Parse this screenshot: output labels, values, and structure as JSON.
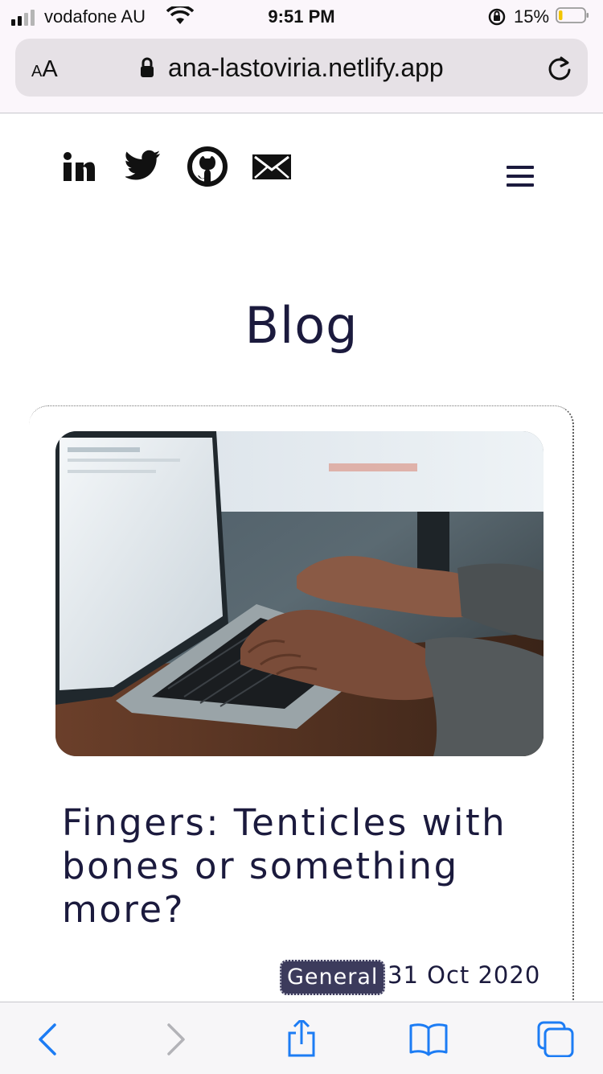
{
  "status_bar": {
    "carrier": "vodafone AU",
    "time": "9:51 PM",
    "battery_percent": "15%",
    "battery_level": 0.15,
    "icons": [
      "signal-icon",
      "wifi-icon",
      "orientation-lock-icon",
      "battery-icon"
    ]
  },
  "browser": {
    "text_size_small": "A",
    "text_size_big": "A",
    "url": "ana-lastoviria.netlify.app",
    "icons": [
      "lock-icon",
      "reload-icon"
    ]
  },
  "header": {
    "social_icons": [
      "linkedin-icon",
      "twitter-icon",
      "github-icon",
      "mail-icon"
    ],
    "menu_icon": "hamburger-menu-icon"
  },
  "page": {
    "title": "Blog"
  },
  "post": {
    "image_alt": "laptop-typing-photo",
    "title": "Fingers: Tenticles with bones or something more?",
    "tag": "General",
    "date": "31 Oct 2020"
  },
  "toolbar": {
    "icons": [
      "back-icon",
      "forward-icon",
      "share-icon",
      "bookmarks-icon",
      "tabs-icon"
    ]
  },
  "colors": {
    "text": "#1b1a3d",
    "tag_bg": "#3c3b5c",
    "ios_blue": "#1c7cf4",
    "disabled": "#b3b3b8"
  }
}
